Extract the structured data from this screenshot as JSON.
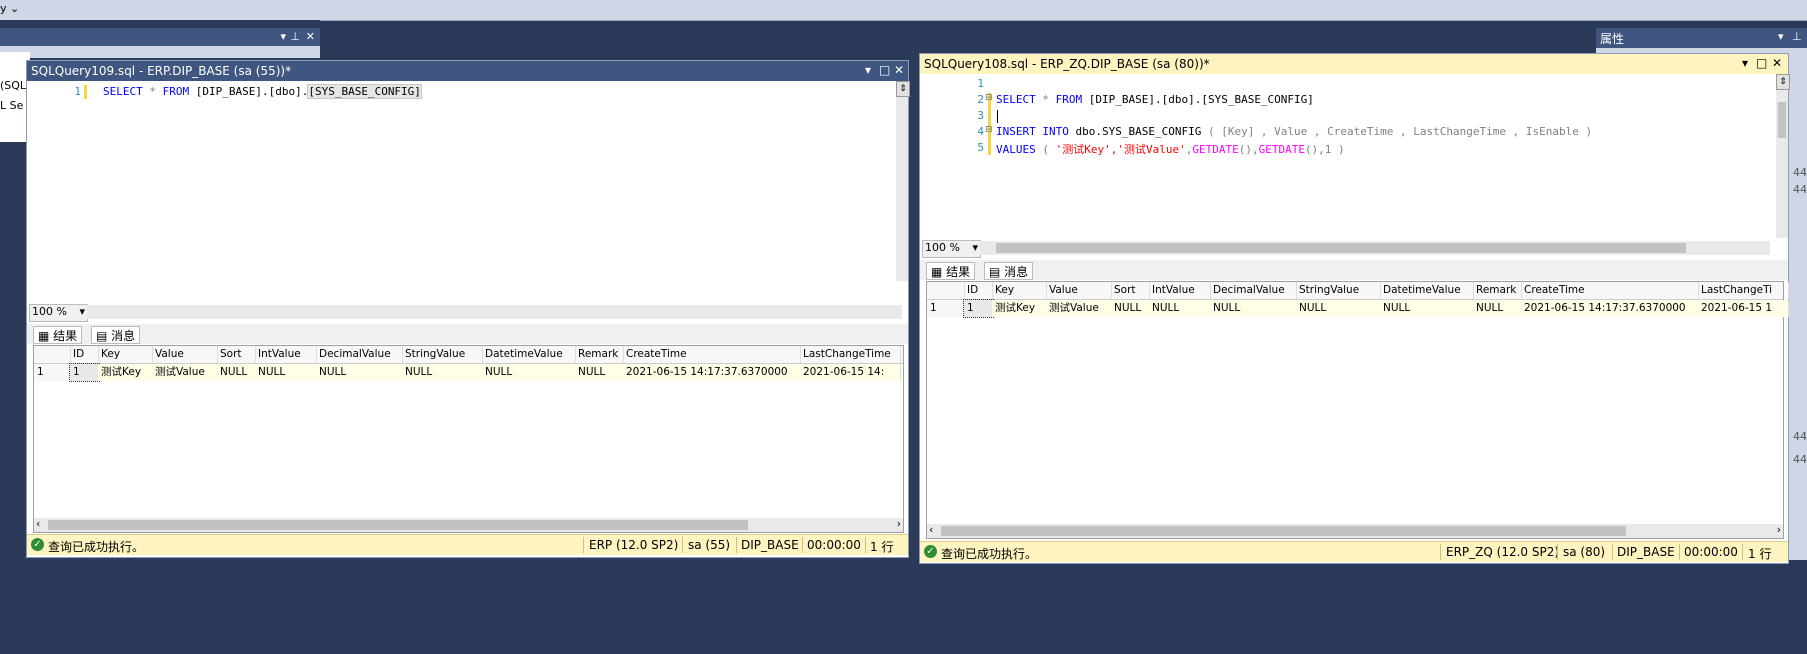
{
  "topbar": {
    "fragment": "y ⌄"
  },
  "left_panel": {
    "frag1": "(SQL",
    "frag2": "L Se"
  },
  "property_panel": {
    "title": "属性",
    "values": [
      "44",
      "44",
      "44",
      "44"
    ]
  },
  "window_left": {
    "title": "SQLQuery109.sql - ERP.DIP_BASE (sa (55))*",
    "controls": [
      "▾",
      "□",
      "✕"
    ],
    "line_numbers": [
      "1"
    ],
    "code": {
      "select": "SELECT",
      "star": "*",
      "from": "FROM",
      "obj1": "[DIP_BASE].[dbo].",
      "obj2": "[SYS_BASE_CONFIG]"
    },
    "zoom": "100 %",
    "tabs": [
      "结果",
      "消息"
    ],
    "columns": [
      "ID",
      "Key",
      "Value",
      "Sort",
      "IntValue",
      "DecimalValue",
      "StringValue",
      "DatetimeValue",
      "Remark",
      "CreateTime",
      "LastChangeTime"
    ],
    "rows": [
      {
        "num": "1",
        "cells": [
          "1",
          "测试Key",
          "测试Value",
          "NULL",
          "NULL",
          "NULL",
          "NULL",
          "NULL",
          "NULL",
          "2021-06-15 14:17:37.6370000",
          "2021-06-15 14:"
        ]
      }
    ],
    "status": {
      "message": "查询已成功执行。",
      "server": "ERP (12.0 SP2)",
      "user": "sa (55)",
      "db": "DIP_BASE",
      "time": "00:00:00",
      "rows": "1 行"
    }
  },
  "window_right": {
    "title": "SQLQuery108.sql - ERP_ZQ.DIP_BASE (sa (80))*",
    "controls": [
      "▾",
      "□",
      "✕"
    ],
    "line_numbers": [
      "1",
      "2",
      "3",
      "4",
      "5"
    ],
    "code": {
      "l2_select": "SELECT",
      "l2_star": "*",
      "l2_from": "FROM",
      "l2_obj": "[DIP_BASE].[dbo].[SYS_BASE_CONFIG]",
      "l4_insert": "INSERT INTO",
      "l4_obj": "dbo.SYS_BASE_CONFIG",
      "l4_cols": "( [Key] , Value , CreateTime , LastChangeTime , IsEnable )",
      "l5_values": "VALUES",
      "l5_open": "(",
      "l5_str": "'测试Key','测试Value'",
      "l5_comma1": ",",
      "l5_fn1": "GETDATE",
      "l5_p1": "(),",
      "l5_fn2": "GETDATE",
      "l5_p2": "(),1 )"
    },
    "zoom": "100 %",
    "tabs": [
      "结果",
      "消息"
    ],
    "columns": [
      "ID",
      "Key",
      "Value",
      "Sort",
      "IntValue",
      "DecimalValue",
      "StringValue",
      "DatetimeValue",
      "Remark",
      "CreateTime",
      "LastChangeTi"
    ],
    "rows": [
      {
        "num": "1",
        "cells": [
          "1",
          "测试Key",
          "测试Value",
          "NULL",
          "NULL",
          "NULL",
          "NULL",
          "NULL",
          "NULL",
          "2021-06-15 14:17:37.6370000",
          "2021-06-15 1"
        ]
      }
    ],
    "status": {
      "message": "查询已成功执行。",
      "server": "ERP_ZQ (12.0 SP2)",
      "user": "sa (80)",
      "db": "DIP_BASE",
      "time": "00:00:00",
      "rows": "1 行"
    }
  }
}
